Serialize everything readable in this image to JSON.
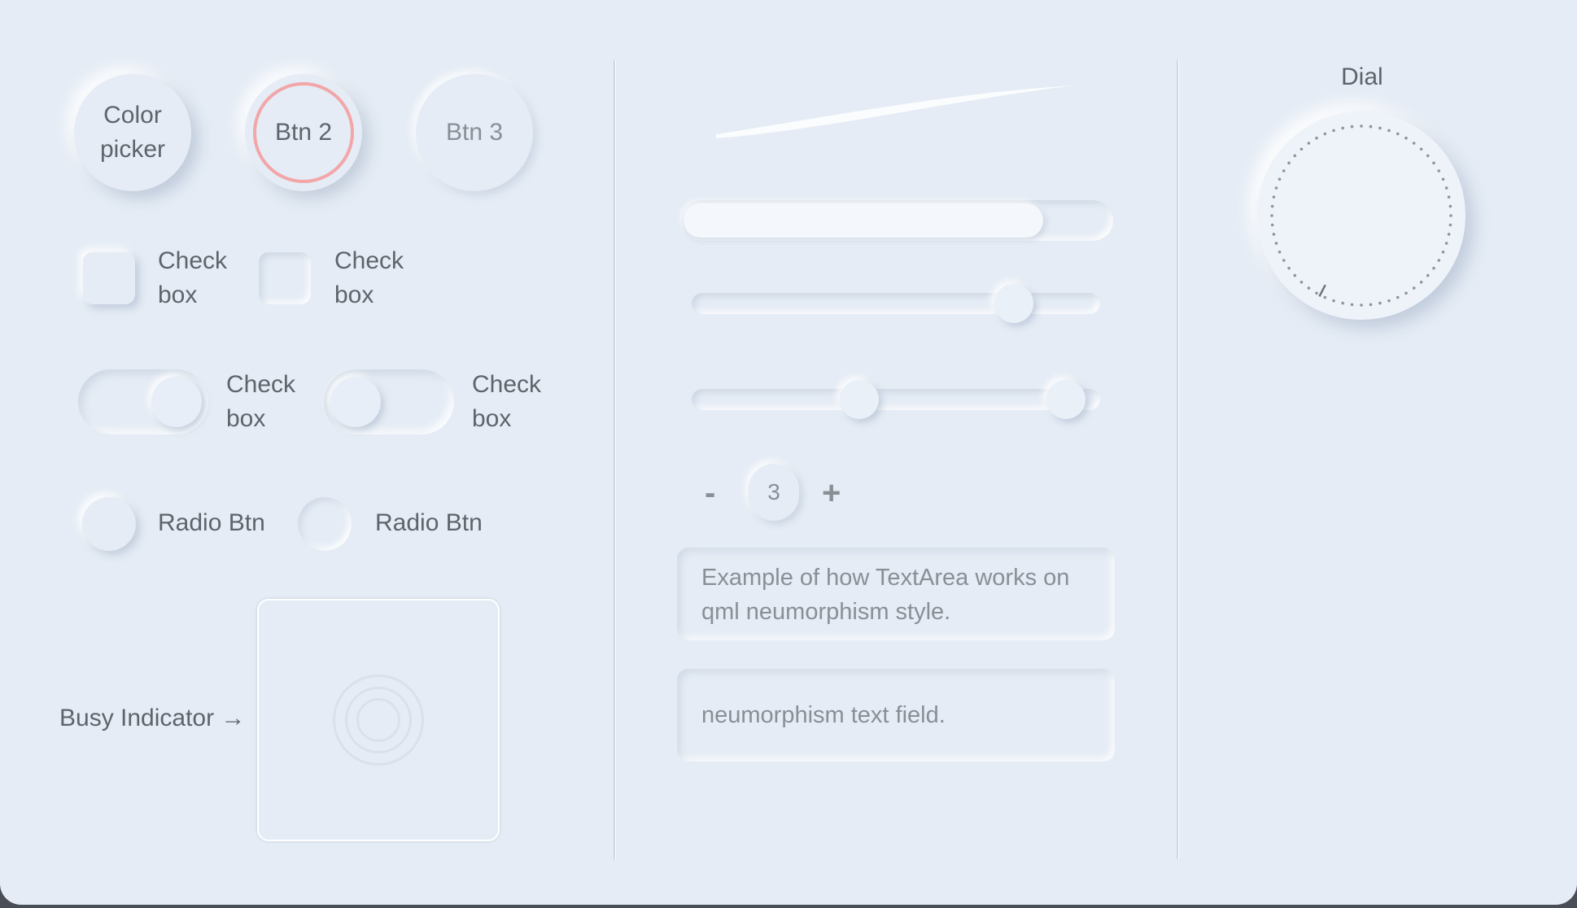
{
  "buttons": {
    "color_picker": "Color\npicker",
    "btn2": "Btn 2",
    "btn3": "Btn 3"
  },
  "checkboxes": [
    {
      "label": "Check\nbox",
      "checked": true
    },
    {
      "label": "Check\nbox",
      "checked": false
    }
  ],
  "switches": [
    {
      "label": "Check\nbox",
      "on": true
    },
    {
      "label": "Check\nbox",
      "on": false
    }
  ],
  "radios": [
    {
      "label": "Radio Btn",
      "checked": true
    },
    {
      "label": "Radio Btn",
      "checked": false
    }
  ],
  "busy": {
    "label": "Busy Indicator →"
  },
  "progress": {
    "value": 0.84
  },
  "slider": {
    "value": 0.82
  },
  "range_slider": {
    "first": 0.4,
    "second": 0.96
  },
  "spinbox": {
    "value": "3",
    "minus": "-",
    "plus": "+"
  },
  "textarea": {
    "text": "Example of how TextArea works on qml neumorphism style."
  },
  "textfield": {
    "text": "neumorphism text field."
  },
  "dial": {
    "title": "Dial"
  },
  "colors": {
    "background": "#e5ecf5",
    "accent_ring": "#f2a6a8",
    "text": "#5f646b",
    "muted_text": "#8a8f96"
  }
}
